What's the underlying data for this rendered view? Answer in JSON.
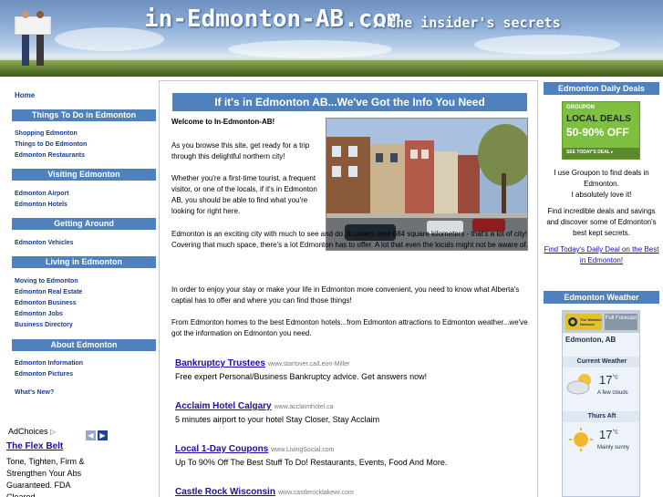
{
  "site": {
    "title": "in-Edmonton-AB.com",
    "tagline": "...the insider's secrets"
  },
  "leftnav": {
    "home": "Home",
    "sections": [
      {
        "heading": "Things To Do in Edmonton",
        "links": [
          "Shopping Edmonton",
          "Things to Do Edmonton",
          "Edmonton Restaurants"
        ]
      },
      {
        "heading": "Visiting Edmonton",
        "links": [
          "Edmonton Airport",
          "Edmonton Hotels"
        ]
      },
      {
        "heading": "Getting Around",
        "links": [
          "Edmonton Vehicles"
        ]
      },
      {
        "heading": "Living in Edmonton",
        "links": [
          "Moving to Edmonton",
          "Edmonton Real Estate",
          "Edmonton Business",
          "Edmonton Jobs",
          "Business Directory"
        ]
      },
      {
        "heading": "About Edmonton",
        "links": [
          "Edmonton Information",
          "Edmonton Pictures"
        ]
      }
    ],
    "whats_new": "What's New?",
    "adchoices": "AdChoices",
    "ad": {
      "title": "The Flex Belt",
      "body": "Tone, Tighten, Firm & Strengthen Your Abs Guaranteed. FDA Cleared."
    }
  },
  "main": {
    "heading": "If it's in Edmonton AB...We've Got the Info You Need",
    "welcome": "Welcome to In-Edmonton-AB!",
    "para1": "As you browse this site, get ready for a trip through this delightful northern city!",
    "para2": "Whether you're a first-time tourist, a frequent visitor, or one of the locals, if it's in Edmonton AB, you should be able to find what you're looking for right here.",
    "para3": "Edmonton is an exciting city with much to see and do. It covers over 684 square kilometers - that's a lot of city! Covering that much space, there's a lot Edmonton has to offer. A lot that even the locals might not be aware of.",
    "para4": "In order to enjoy your stay or make your life in Edmonton more convenient, you need to know what Alberta's captial has to offer and where you can find those things!",
    "para5": "From Edmonton homes to the best Edmonton hotels...from Edmonton attractions to Edmonton weather...we've got the information on Edmonton you need.",
    "ads": [
      {
        "title": "Bankruptcy Trustees",
        "url": "www.startover.ca/Leon-Miller",
        "text": "Free expert Personal/Business Bankruptcy advice. Get answers now!"
      },
      {
        "title": "Acclaim Hotel Calgary",
        "url": "www.acclaimhotel.ca",
        "text": "5 minutes airport to your hotel Stay Closer, Stay Acclaim"
      },
      {
        "title": "Local 1-Day Coupons",
        "url": "www.LivingSocial.com",
        "text": "Up To 90% Off The Best Stuff To Do! Restaurants, Events, Food And More."
      },
      {
        "title": "Castle Rock Wisconsin",
        "url": "www.castlerocklakewi.com",
        "text": ""
      }
    ]
  },
  "right": {
    "deals_heading": "Edmonton Daily Deals",
    "groupon": {
      "brand": "GROUPON",
      "line1": "LOCAL DEALS",
      "line2": "50-90% OFF",
      "cta": "SEE TODAY'S DEAL ▸"
    },
    "groupon_text": "I use Groupon to find deals in Edmonton.",
    "love_text": "I absolutely love it!",
    "find_text": "Find incredible deals and savings and discover some of Edmonton's best kept secrets.",
    "find_link": "Find Today's Daily Deal on the Best in Edmonton!",
    "weather_heading": "Edmonton Weather",
    "weather": {
      "brand": "The Weather Network",
      "full_forecast": "Full Forecast",
      "city": "Edmonton, AB",
      "current_label": "Current Weather",
      "current_temp": "17",
      "unit": "°c",
      "current_cond": "A few clouds",
      "next_label": "Thurs Aft",
      "next_temp": "17",
      "next_cond": "Mainly sunny"
    }
  }
}
